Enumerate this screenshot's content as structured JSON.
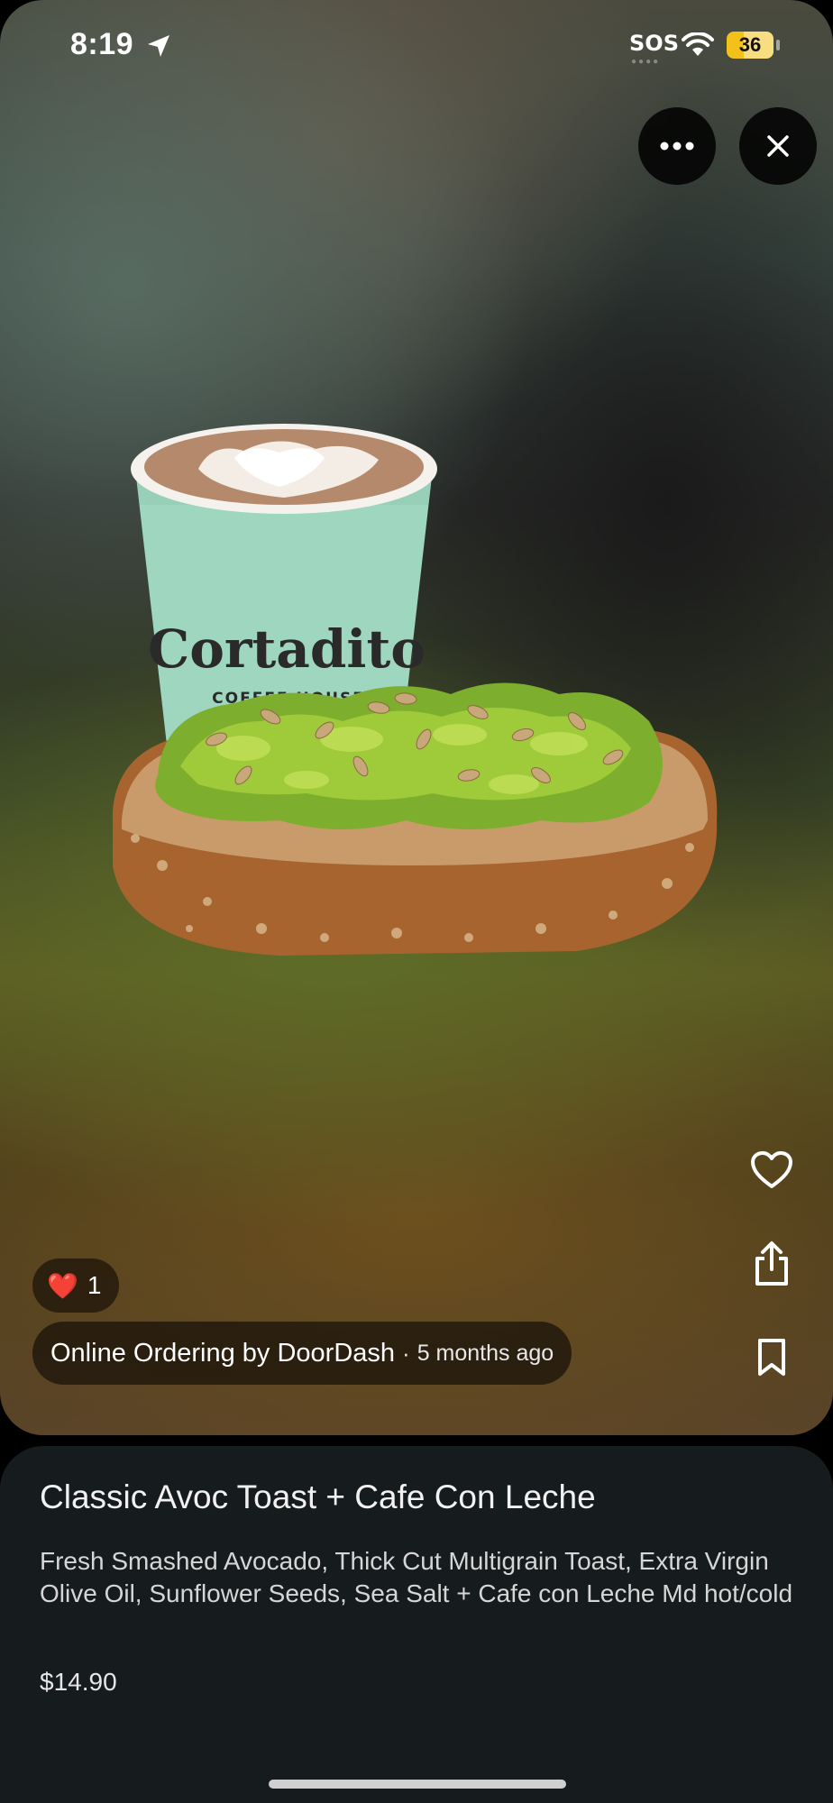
{
  "status_bar": {
    "time": "8:19",
    "carrier_status": "SOS",
    "battery_level": "36",
    "battery_fraction": 0.36
  },
  "top_actions": {
    "more_icon": "ellipsis-icon",
    "close_icon": "close-icon"
  },
  "photo": {
    "cup_brand": "Cortadito",
    "cup_subtitle": "COFFEE HOUSE"
  },
  "side_actions": {
    "like_icon": "heart-outline-icon",
    "share_icon": "share-icon",
    "save_icon": "bookmark-icon"
  },
  "reaction": {
    "emoji": "❤️",
    "count": "1"
  },
  "source": {
    "name": "Online Ordering by DoorDash",
    "separator": "·",
    "time_ago": "5 months ago"
  },
  "item": {
    "title": "Classic Avoc Toast + Cafe Con Leche",
    "description": "Fresh Smashed Avocado, Thick Cut Multigrain Toast, Extra Virgin Olive Oil, Sunflower Seeds, Sea Salt + Cafe con Leche Md hot/cold",
    "price": "$14.90"
  },
  "colors": {
    "sheet_background": "#161b1d",
    "battery_accent": "#f2c21b"
  }
}
